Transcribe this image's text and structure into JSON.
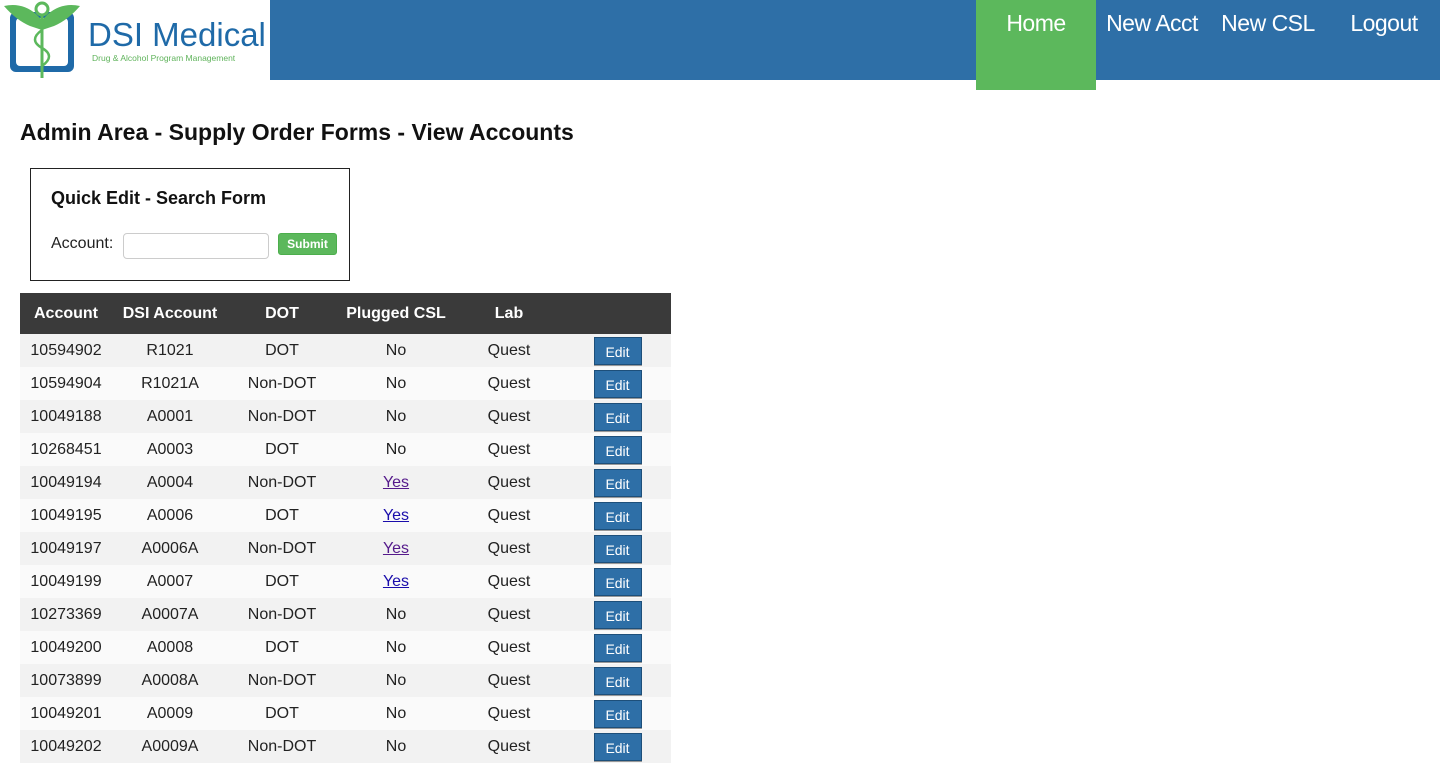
{
  "brand": {
    "name": "DSI Medical",
    "tagline": "Drug & Alcohol Program Management",
    "colors": {
      "blue": "#2e6fa7",
      "green": "#5cb85c"
    }
  },
  "nav": {
    "items": [
      {
        "label": "Home",
        "active": true
      },
      {
        "label": "New Acct"
      },
      {
        "label": "New CSL"
      },
      {
        "label": "Logout"
      }
    ]
  },
  "page": {
    "title": "Admin Area - Supply Order Forms - View Accounts"
  },
  "search": {
    "title": "Quick Edit - Search Form",
    "account_label": "Account:",
    "account_value": "",
    "submit_label": "Submit"
  },
  "table": {
    "columns": [
      "Account",
      "DSI Account",
      "DOT",
      "Plugged CSL",
      "Lab",
      ""
    ],
    "edit_label": "Edit",
    "rows": [
      {
        "account": "10594902",
        "dsi": "R1021",
        "dot": "DOT",
        "csl": "No",
        "lab": "Quest"
      },
      {
        "account": "10594904",
        "dsi": "R1021A",
        "dot": "Non-DOT",
        "csl": "No",
        "lab": "Quest"
      },
      {
        "account": "10049188",
        "dsi": "A0001",
        "dot": "Non-DOT",
        "csl": "No",
        "lab": "Quest"
      },
      {
        "account": "10268451",
        "dsi": "A0003",
        "dot": "DOT",
        "csl": "No",
        "lab": "Quest"
      },
      {
        "account": "10049194",
        "dsi": "A0004",
        "dot": "Non-DOT",
        "csl": "Yes",
        "lab": "Quest"
      },
      {
        "account": "10049195",
        "dsi": "A0006",
        "dot": "DOT",
        "csl": "Yes",
        "lab": "Quest"
      },
      {
        "account": "10049197",
        "dsi": "A0006A",
        "dot": "Non-DOT",
        "csl": "Yes",
        "lab": "Quest"
      },
      {
        "account": "10049199",
        "dsi": "A0007",
        "dot": "DOT",
        "csl": "Yes",
        "lab": "Quest"
      },
      {
        "account": "10273369",
        "dsi": "A0007A",
        "dot": "Non-DOT",
        "csl": "No",
        "lab": "Quest"
      },
      {
        "account": "10049200",
        "dsi": "A0008",
        "dot": "DOT",
        "csl": "No",
        "lab": "Quest"
      },
      {
        "account": "10073899",
        "dsi": "A0008A",
        "dot": "Non-DOT",
        "csl": "No",
        "lab": "Quest"
      },
      {
        "account": "10049201",
        "dsi": "A0009",
        "dot": "DOT",
        "csl": "No",
        "lab": "Quest"
      },
      {
        "account": "10049202",
        "dsi": "A0009A",
        "dot": "Non-DOT",
        "csl": "No",
        "lab": "Quest"
      }
    ]
  }
}
